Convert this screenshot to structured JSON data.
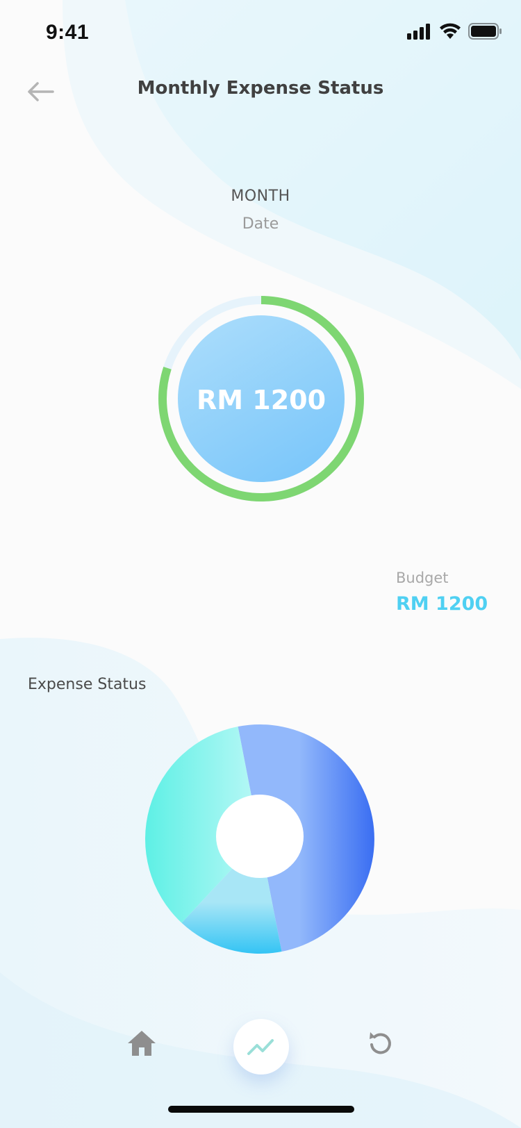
{
  "status_bar": {
    "time": "9:41"
  },
  "header": {
    "title": "Monthly Expense Status",
    "back_icon": "arrow-left-icon"
  },
  "period": {
    "month_label": "MONTH",
    "date_label": "Date"
  },
  "summary_ring": {
    "amount": "RM 1200",
    "progress": 0.8,
    "color": "#7ed672"
  },
  "budget": {
    "label": "Budget",
    "value": "RM 1200",
    "color": "#4fd0f2"
  },
  "expense_section": {
    "heading": "Expense Status"
  },
  "chart_data": {
    "type": "pie",
    "variant": "donut",
    "slices": [
      {
        "value": 0.5,
        "color": "#6d8ff5"
      },
      {
        "value": 0.15,
        "color": "#3ec6f3"
      },
      {
        "value": 0.35,
        "color": "#7cf1e8"
      }
    ]
  },
  "bottom_nav": {
    "items": [
      {
        "icon": "home-icon"
      },
      {
        "icon": "trending-up-icon",
        "active": true
      },
      {
        "icon": "history-icon"
      }
    ]
  }
}
